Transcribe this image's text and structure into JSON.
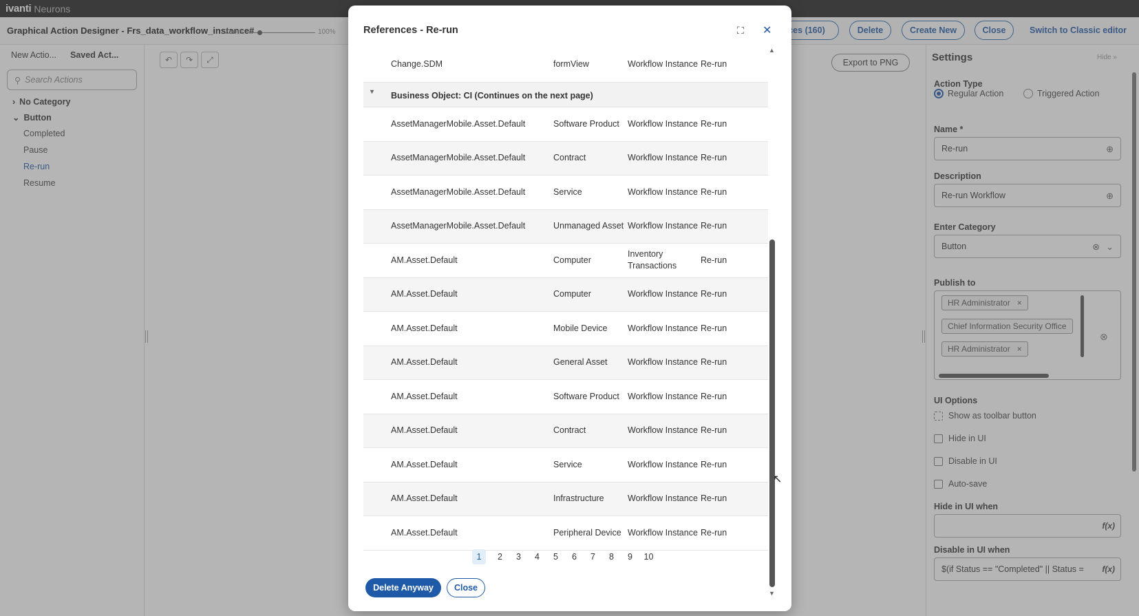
{
  "topbar": {
    "brand": "ivanti",
    "brand_sub": "Neurons"
  },
  "header": {
    "title": "Graphical Action Designer - Frs_data_workflow_instance#",
    "buttons": {
      "references": "ces (160)",
      "delete": "Delete",
      "create_new": "Create New",
      "close": "Close"
    },
    "switch_link": "Switch to Classic editor"
  },
  "left_panel": {
    "tabs": [
      "New Actio...",
      "Saved Act..."
    ],
    "search_placeholder": "Search Actions",
    "groups": [
      {
        "label": "No Category",
        "icon": "chevron-right-icon"
      },
      {
        "label": "Button",
        "icon": "chevron-down-icon"
      }
    ],
    "items": [
      "Completed",
      "Pause",
      "Re-run",
      "Resume"
    ],
    "active_item": "Re-run"
  },
  "canvas": {
    "zoom_label": "Zoom:",
    "zoom_value": "100%",
    "export_button": "Export to PNG",
    "tools": [
      "undo-icon",
      "redo-icon",
      "fit-icon"
    ]
  },
  "settings": {
    "title": "Settings",
    "hide": "Hide »",
    "action_type_label": "Action Type",
    "action_types": [
      "Regular Action",
      "Triggered Action"
    ],
    "selected_action_type": "Regular Action",
    "name_label": "Name *",
    "name_value": "Re-run",
    "description_label": "Description",
    "description_value": "Re-run Workflow",
    "category_label": "Enter Category",
    "category_value": "Button",
    "publish_label": "Publish to",
    "publish_tags": [
      "HR Administrator",
      "Chief Information Security Office",
      "HR Administrator"
    ],
    "ui_options_label": "UI Options",
    "ui_options": [
      "Show as toolbar button",
      "Hide in UI",
      "Disable in UI",
      "Auto-save"
    ],
    "hide_when_label": "Hide in UI when",
    "hide_when_value": "",
    "disable_when_label": "Disable in UI when",
    "disable_when_value": "$(if Status == \"Completed\" || Status =",
    "fx_label": "f(x)"
  },
  "modal": {
    "title": "References - Re-run",
    "rows_top": [
      {
        "name": "Change.SDM",
        "type": "formView",
        "usage": "Workflow Instance",
        "action": "Re-run"
      }
    ],
    "group_title": "Business Object: CI (Continues on the next page)",
    "rows": [
      {
        "name": "AssetManagerMobile.Asset.Default",
        "type": "Software Product",
        "usage": "Workflow Instance",
        "action": "Re-run"
      },
      {
        "name": "AssetManagerMobile.Asset.Default",
        "type": "Contract",
        "usage": "Workflow Instance",
        "action": "Re-run"
      },
      {
        "name": "AssetManagerMobile.Asset.Default",
        "type": "Service",
        "usage": "Workflow Instance",
        "action": "Re-run"
      },
      {
        "name": "AssetManagerMobile.Asset.Default",
        "type": "Unmanaged Asset",
        "usage": "Workflow Instance",
        "action": "Re-run"
      },
      {
        "name": "AM.Asset.Default",
        "type": "Computer",
        "usage": "Inventory Transactions",
        "action": "Re-run"
      },
      {
        "name": "AM.Asset.Default",
        "type": "Computer",
        "usage": "Workflow Instance",
        "action": "Re-run"
      },
      {
        "name": "AM.Asset.Default",
        "type": "Mobile Device",
        "usage": "Workflow Instance",
        "action": "Re-run"
      },
      {
        "name": "AM.Asset.Default",
        "type": "General Asset",
        "usage": "Workflow Instance",
        "action": "Re-run"
      },
      {
        "name": "AM.Asset.Default",
        "type": "Software Product",
        "usage": "Workflow Instance",
        "action": "Re-run"
      },
      {
        "name": "AM.Asset.Default",
        "type": "Contract",
        "usage": "Workflow Instance",
        "action": "Re-run"
      },
      {
        "name": "AM.Asset.Default",
        "type": "Service",
        "usage": "Workflow Instance",
        "action": "Re-run"
      },
      {
        "name": "AM.Asset.Default",
        "type": "Infrastructure",
        "usage": "Workflow Instance",
        "action": "Re-run"
      },
      {
        "name": "AM.Asset.Default",
        "type": "Peripheral Device",
        "usage": "Workflow Instance",
        "action": "Re-run"
      }
    ],
    "pages": [
      "1",
      "2",
      "3",
      "4",
      "5",
      "6",
      "7",
      "8",
      "9",
      "10"
    ],
    "current_page": "1",
    "delete_anyway": "Delete Anyway",
    "close": "Close"
  },
  "colors": {
    "accent": "#1f5aa8",
    "topbar": "#222222",
    "overlay": "rgba(90,90,90,0.45)"
  }
}
